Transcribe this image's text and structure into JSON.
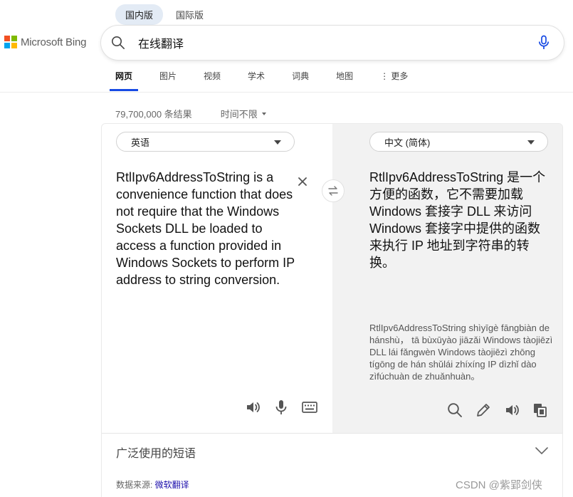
{
  "region_tabs": [
    {
      "label": "国内版",
      "active": true
    },
    {
      "label": "国际版",
      "active": false
    }
  ],
  "logo": {
    "text": "Microsoft Bing"
  },
  "search": {
    "value": "在线翻译"
  },
  "nav": [
    {
      "label": "网页",
      "active": true
    },
    {
      "label": "图片",
      "active": false
    },
    {
      "label": "视频",
      "active": false
    },
    {
      "label": "学术",
      "active": false
    },
    {
      "label": "词典",
      "active": false
    },
    {
      "label": "地图",
      "active": false
    },
    {
      "label": "⋮ 更多",
      "active": false
    }
  ],
  "meta": {
    "results_count": "79,700,000 条结果",
    "time_filter": "时间不限"
  },
  "translator": {
    "source_lang": "英语",
    "target_lang": "中文 (简体)",
    "source_text": "RtlIpv6AddressToString is a convenience function that does not require that the Windows Sockets DLL be loaded to access a function provided in Windows Sockets to perform IP address to string conversion.",
    "target_text": "RtlIpv6AddressToString 是一个方便的函数，它不需要加载 Windows 套接字 DLL 来访问 Windows 套接字中提供的函数来执行 IP 地址到字符串的转换。",
    "pinyin": "RtlIpv6AddressToString shìyīgè fāngbiàn de hánshù， tā bùxūyào jiāzǎi Windows tàojiēzì DLL lái fǎngwèn Windows tàojiēzì zhōng tígōng de hán shǔlái zhíxíng IP dìzhǐ dào zìfúchuàn de zhuǎnhuàn。",
    "common_phrases": "广泛使用的短语",
    "source_label": "数据来源: ",
    "source_link": "微软翻译"
  },
  "watermark": "CSDN @紫郢剑侠",
  "colors": {
    "accent": "#174ae4",
    "ms_red": "#f25022",
    "ms_green": "#7fba00",
    "ms_blue": "#00a4ef",
    "ms_yellow": "#ffb900",
    "mic_blue": "#174ae4"
  }
}
